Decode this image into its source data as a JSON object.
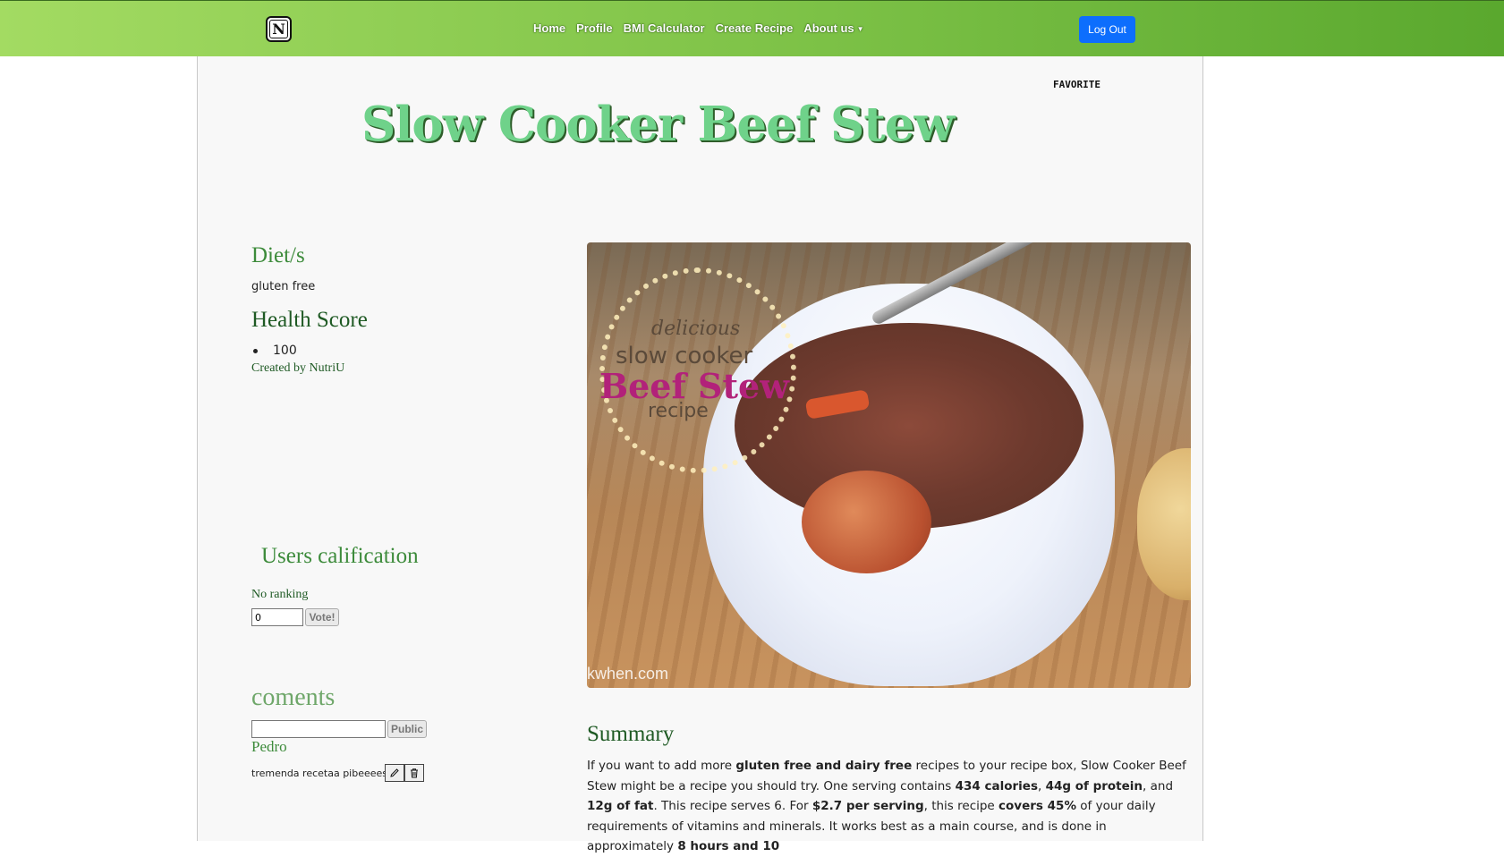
{
  "nav": {
    "logo_letter": "N",
    "links": [
      "Home",
      "Profile",
      "BMI Calculator",
      "Create Recipe",
      "About us"
    ],
    "logout": "Log Out"
  },
  "recipe": {
    "favorite": "FAVORITE",
    "title": "Slow Cooker Beef Stew",
    "diet_heading": "Diet/s",
    "diet": "gluten free",
    "health_heading": "Health Score",
    "health_score": "100",
    "created_by": "Created by NutriU",
    "image": {
      "text_line1": "delicious",
      "text_line2": "slow cooker",
      "text_line3": "Beef Stew",
      "text_line4": "recipe",
      "watermark": "kwhen.com"
    }
  },
  "rating": {
    "heading": "Users calification",
    "status": "No ranking",
    "input_value": "0",
    "vote_label": "Vote!"
  },
  "comments": {
    "heading": "coments",
    "public_label": "Public",
    "items": [
      {
        "author": "Pedro",
        "text": "tremenda recetaa pibeeeess"
      }
    ]
  },
  "summary": {
    "heading": "Summary",
    "p1": "If you want to add more ",
    "b1": "gluten free and dairy free",
    "p2": " recipes to your recipe box, Slow Cooker Beef Stew might be a recipe you should try. One serving contains ",
    "b2": "434 calories",
    "p3": ", ",
    "b3": "44g of protein",
    "p4": ", and ",
    "b4": "12g of fat",
    "p5": ". This recipe serves 6. For ",
    "b5": "$2.7 per serving",
    "p6": ", this recipe ",
    "b6": "covers 45%",
    "p7": " of your daily requirements of vitamins and minerals. It works best as a main course, and is done in approximately ",
    "b7": "8 hours and 10"
  },
  "colors": {
    "nav_gradient_start": "#a3db62",
    "nav_gradient_end": "#5aa82e",
    "logout_blue": "#0d6efd",
    "title_green": "#6fd28a",
    "heading_green": "#3d8b3b",
    "dark_green": "#1f5a24"
  }
}
